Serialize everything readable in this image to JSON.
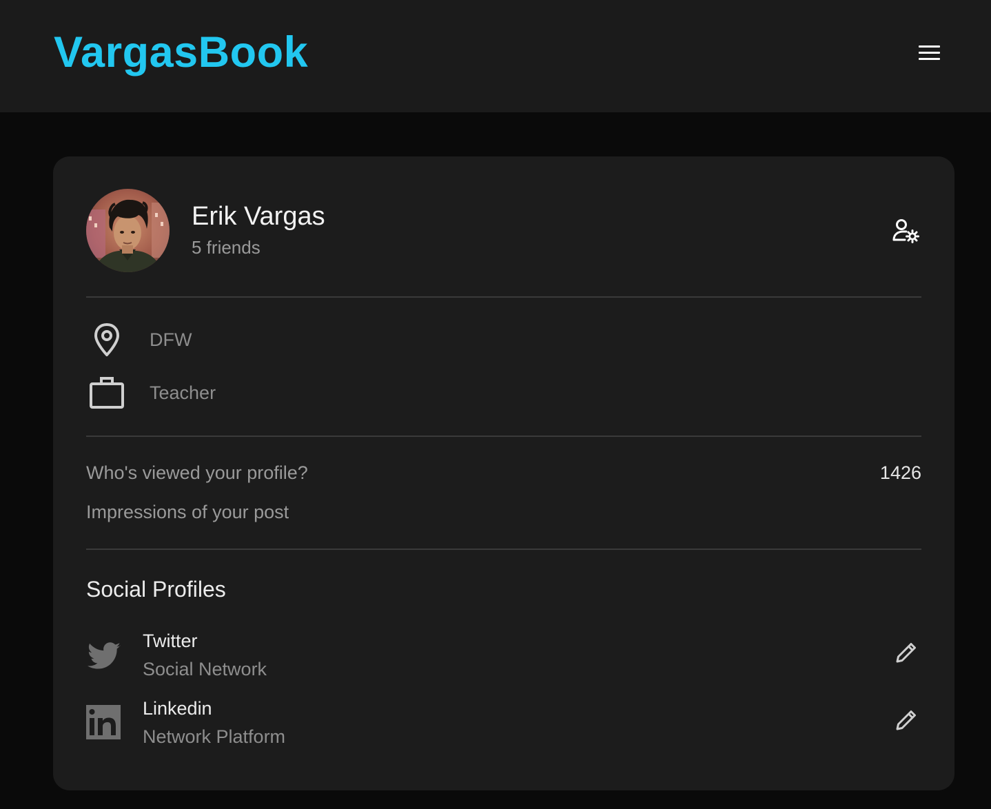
{
  "header": {
    "brand": "VargasBook",
    "menu_icon": "hamburger-menu-icon",
    "brand_color": "#22c7f0"
  },
  "profile": {
    "name": "Erik Vargas",
    "friends": "5 friends",
    "settings_icon": "user-settings-icon"
  },
  "info": {
    "location": "DFW",
    "location_icon": "map-pin-icon",
    "occupation": "Teacher",
    "occupation_icon": "briefcase-icon"
  },
  "stats": [
    {
      "label": "Who's viewed your profile?",
      "value": "1426"
    },
    {
      "label": "Impressions of your post",
      "value": ""
    }
  ],
  "social": {
    "title": "Social Profiles",
    "items": [
      {
        "name": "Twitter",
        "subtitle": "Social Network",
        "icon": "twitter-icon",
        "edit_icon": "pencil-icon"
      },
      {
        "name": "Linkedin",
        "subtitle": "Network Platform",
        "icon": "linkedin-icon",
        "edit_icon": "pencil-icon"
      }
    ]
  },
  "colors": {
    "page_background": "#0a0a0a",
    "surface": "#1c1c1c",
    "header_background": "#1b1b1b"
  }
}
